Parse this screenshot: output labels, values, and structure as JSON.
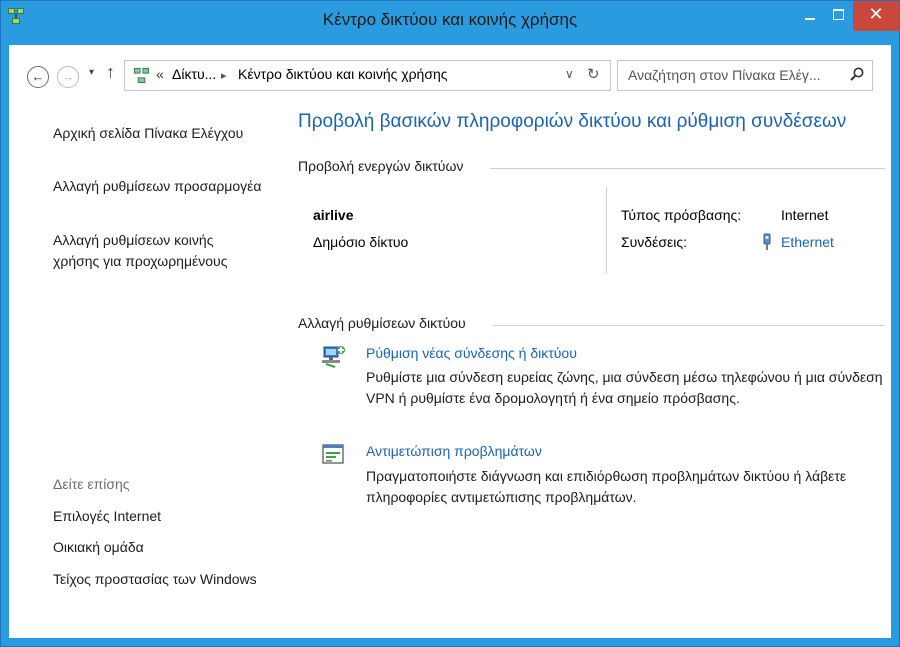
{
  "window": {
    "title": "Κέντρο δικτύου και κοινής χρήσης",
    "controls": {
      "minimize": "–",
      "maximize": "□",
      "close": "✕"
    },
    "accent": "#2a9bde",
    "close_color": "#c9473b"
  },
  "nav": {
    "back_icon": "←",
    "forward_icon": "→",
    "recent_icon": "▾",
    "up_icon": "↑",
    "breadcrumb": {
      "overflow": "«",
      "crumb1": "Δίκτυ...",
      "separator": "▸",
      "crumb2": "Κέντρο δικτύου και κοινής χρήσης"
    },
    "dropdown_icon": "∨",
    "refresh_icon": "↻",
    "search_placeholder": "Αναζήτηση στον Πίνακα Ελέγ..."
  },
  "sidebar": {
    "items": [
      "Αρχική σελίδα Πίνακα Ελέγχου",
      "Αλλαγή ρυθμίσεων προσαρμογέα",
      "Αλλαγή ρυθμίσεων κοινής χρήσης για προχωρημένους"
    ],
    "see_also_label": "Δείτε επίσης",
    "see_also": [
      "Επιλογές Internet",
      "Οικιακή ομάδα",
      "Τείχος προστασίας των Windows"
    ]
  },
  "main": {
    "heading": "Προβολή βασικών πληροφοριών δικτύου και ρύθμιση συνδέσεων",
    "active_networks_title": "Προβολή ενεργών δικτύων",
    "network": {
      "name": "airlive",
      "category": "Δημόσιο δίκτυο",
      "access_type_label": "Τύπος πρόσβασης:",
      "access_type_value": "Internet",
      "connections_label": "Συνδέσεις:",
      "connections_value": "Ethernet"
    },
    "change_settings_title": "Αλλαγή ρυθμίσεων δικτύου",
    "tasks": [
      {
        "icon": "network-setup-icon",
        "link": "Ρύθμιση νέας σύνδεσης ή δικτύου",
        "description": "Ρυθμίστε μια σύνδεση ευρείας ζώνης, μια σύνδεση μέσω τηλεφώνου ή μια σύνδεση VPN ή ρυθμίστε ένα δρομολογητή ή ένα σημείο πρόσβασης."
      },
      {
        "icon": "troubleshoot-icon",
        "link": "Αντιμετώπιση προβλημάτων",
        "description": "Πραγματοποιήστε διάγνωση και επιδιόρθωση προβλημάτων δικτύου ή λάβετε πληροφορίες αντιμετώπισης προβλημάτων."
      }
    ]
  },
  "colors": {
    "link": "#1a63b2",
    "frame": "#2a9bde"
  }
}
